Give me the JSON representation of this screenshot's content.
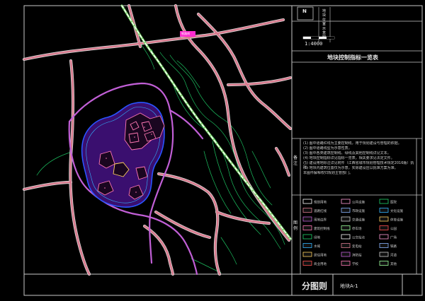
{
  "titleblock": {
    "north": "N",
    "vertical_title": "地块位置示意图",
    "scale": "1:4000",
    "table_heading": "地块控制指标一览表",
    "notes_label": "备注",
    "legend_label": "图例",
    "sheet_title": "分图则",
    "sheet_no": "地块A-1"
  },
  "notes": [
    "(1) 图中道路红线为主要控制线，用于规划建设与管理的依据。",
    "(2) 图中道路线型为示意性质。",
    "(3) 图中各类建筑控制线、绿线及其他控制线详见文本。",
    "(4) 地块控制指标详见指标一览表，相关要求见法定文件。",
    "(5) 建设用地标注详见附件（江西省城市规划管理技术规定2016版）执行。",
    "(6) 地块内建筑位置仅为示意，实际建设应以批准方案为准。",
    "本图件解释权归规划主管部门。"
  ],
  "legend": [
    "规划用地",
    "道路红线",
    "用地边界",
    "建筑控制线",
    "绿地",
    "水域",
    "居住用地",
    "商业用地",
    "公共设施",
    "市政设施",
    "交通设施",
    "停车场",
    "公交站点",
    "变电站",
    "消防站",
    "学校",
    "医院",
    "文化设施",
    "体育设施",
    "公园",
    "广场",
    "铁路",
    "河道",
    "其他"
  ],
  "map": {
    "road_tag": "铁路线",
    "colors": {
      "road": "#d97a8e",
      "road_outline": "#ffffff",
      "district_road": "#c15fd6",
      "green_line": "#1fd46a",
      "railway": "#7bd36b",
      "building": "#ff77b4",
      "site_fill": "#3a0f6f",
      "frame": "#c8c8c8"
    }
  }
}
